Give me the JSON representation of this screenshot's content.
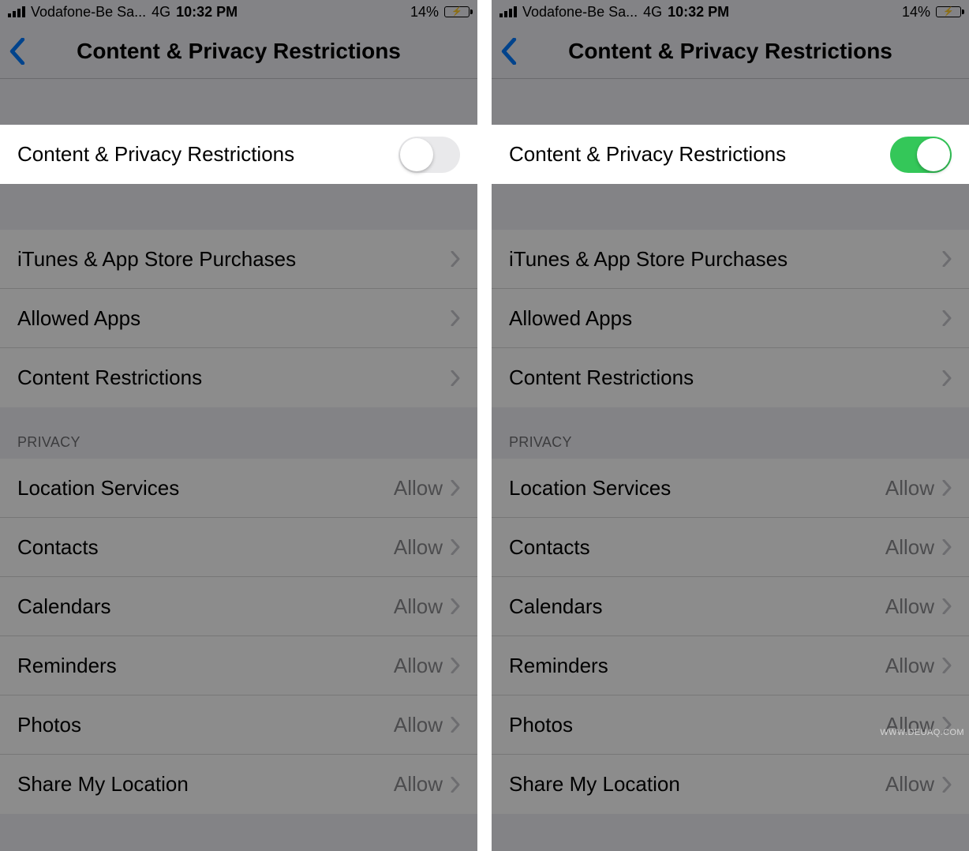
{
  "status": {
    "carrier": "Vodafone-Be Sa...",
    "network": "4G",
    "time": "10:32 PM",
    "battery_percent": "14%"
  },
  "nav": {
    "title": "Content & Privacy Restrictions"
  },
  "toggle_row": {
    "label": "Content & Privacy Restrictions"
  },
  "group1": {
    "items": [
      {
        "label": "iTunes & App Store Purchases"
      },
      {
        "label": "Allowed Apps"
      },
      {
        "label": "Content Restrictions"
      }
    ]
  },
  "privacy": {
    "header": "PRIVACY",
    "value_label": "Allow",
    "items": [
      {
        "label": "Location Services"
      },
      {
        "label": "Contacts"
      },
      {
        "label": "Calendars"
      },
      {
        "label": "Reminders"
      },
      {
        "label": "Photos"
      },
      {
        "label": "Share My Location"
      }
    ]
  },
  "left": {
    "toggle_on": false
  },
  "right": {
    "toggle_on": true
  },
  "watermark": "WWW.DEUAQ.COM"
}
